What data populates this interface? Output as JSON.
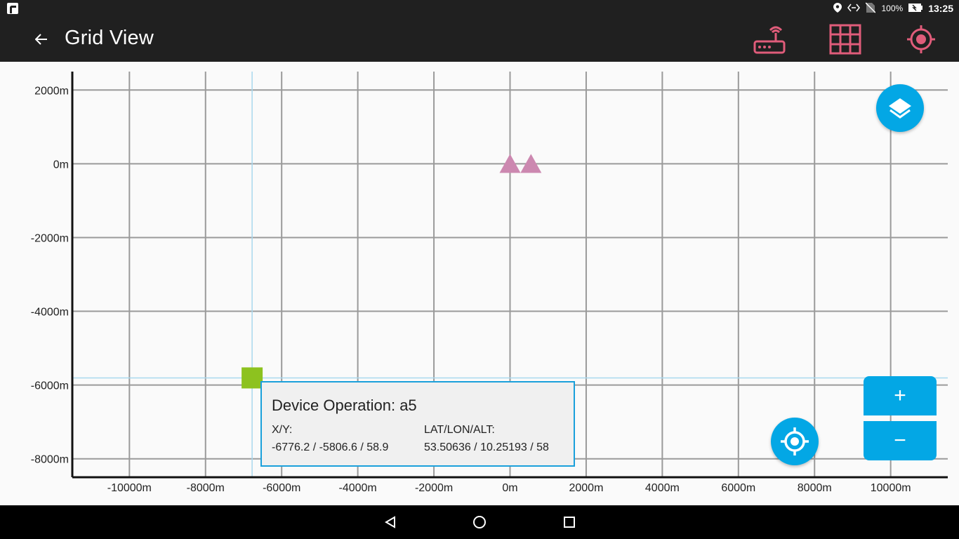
{
  "status_bar": {
    "battery": "100%",
    "time": "13:25",
    "icons": [
      "location-icon",
      "network-icon",
      "no-sim-icon",
      "battery-icon"
    ]
  },
  "app_bar": {
    "title": "Grid View",
    "actions": [
      "router-icon",
      "grid-icon",
      "target-icon"
    ],
    "action_color": "#e05c7a"
  },
  "chart_data": {
    "type": "scatter",
    "xlim": [
      -11500,
      11500
    ],
    "ylim": [
      -8500,
      2500
    ],
    "x_ticks": [
      {
        "value": -10000,
        "label": "-10000m"
      },
      {
        "value": -8000,
        "label": "-8000m"
      },
      {
        "value": -6000,
        "label": "-6000m"
      },
      {
        "value": -4000,
        "label": "-4000m"
      },
      {
        "value": -2000,
        "label": "-2000m"
      },
      {
        "value": 0,
        "label": "0m"
      },
      {
        "value": 2000,
        "label": "2000m"
      },
      {
        "value": 4000,
        "label": "4000m"
      },
      {
        "value": 6000,
        "label": "6000m"
      },
      {
        "value": 8000,
        "label": "8000m"
      },
      {
        "value": 10000,
        "label": "10000m"
      }
    ],
    "y_ticks": [
      {
        "value": 2000,
        "label": "2000m"
      },
      {
        "value": 0,
        "label": "0m"
      },
      {
        "value": -2000,
        "label": "-2000m"
      },
      {
        "value": -4000,
        "label": "-4000m"
      },
      {
        "value": -6000,
        "label": "-6000m"
      },
      {
        "value": -8000,
        "label": "-8000m"
      }
    ],
    "grid": true,
    "crosshair": {
      "x": -6776.2,
      "y": -5806.6
    },
    "selected_marker": {
      "x": -6776.2,
      "y": -5806.6,
      "shape": "square",
      "color": "#8dc21f"
    },
    "markers": [
      {
        "x": 0,
        "y": 0,
        "shape": "triangle",
        "color": "#cc88b0"
      },
      {
        "x": 550,
        "y": 0,
        "shape": "triangle",
        "color": "#cc88b0"
      }
    ]
  },
  "popup": {
    "title": "Device Operation: a5",
    "xy_label": "X/Y:",
    "xy_value": "-6776.2 / -5806.6 / 58.9",
    "latlon_label": "LAT/LON/ALT:",
    "latlon_value": "53.50636 / 10.25193 / 58"
  },
  "controls": {
    "zoom_in": "+",
    "zoom_out": "−",
    "accent": "#03a7e5"
  }
}
